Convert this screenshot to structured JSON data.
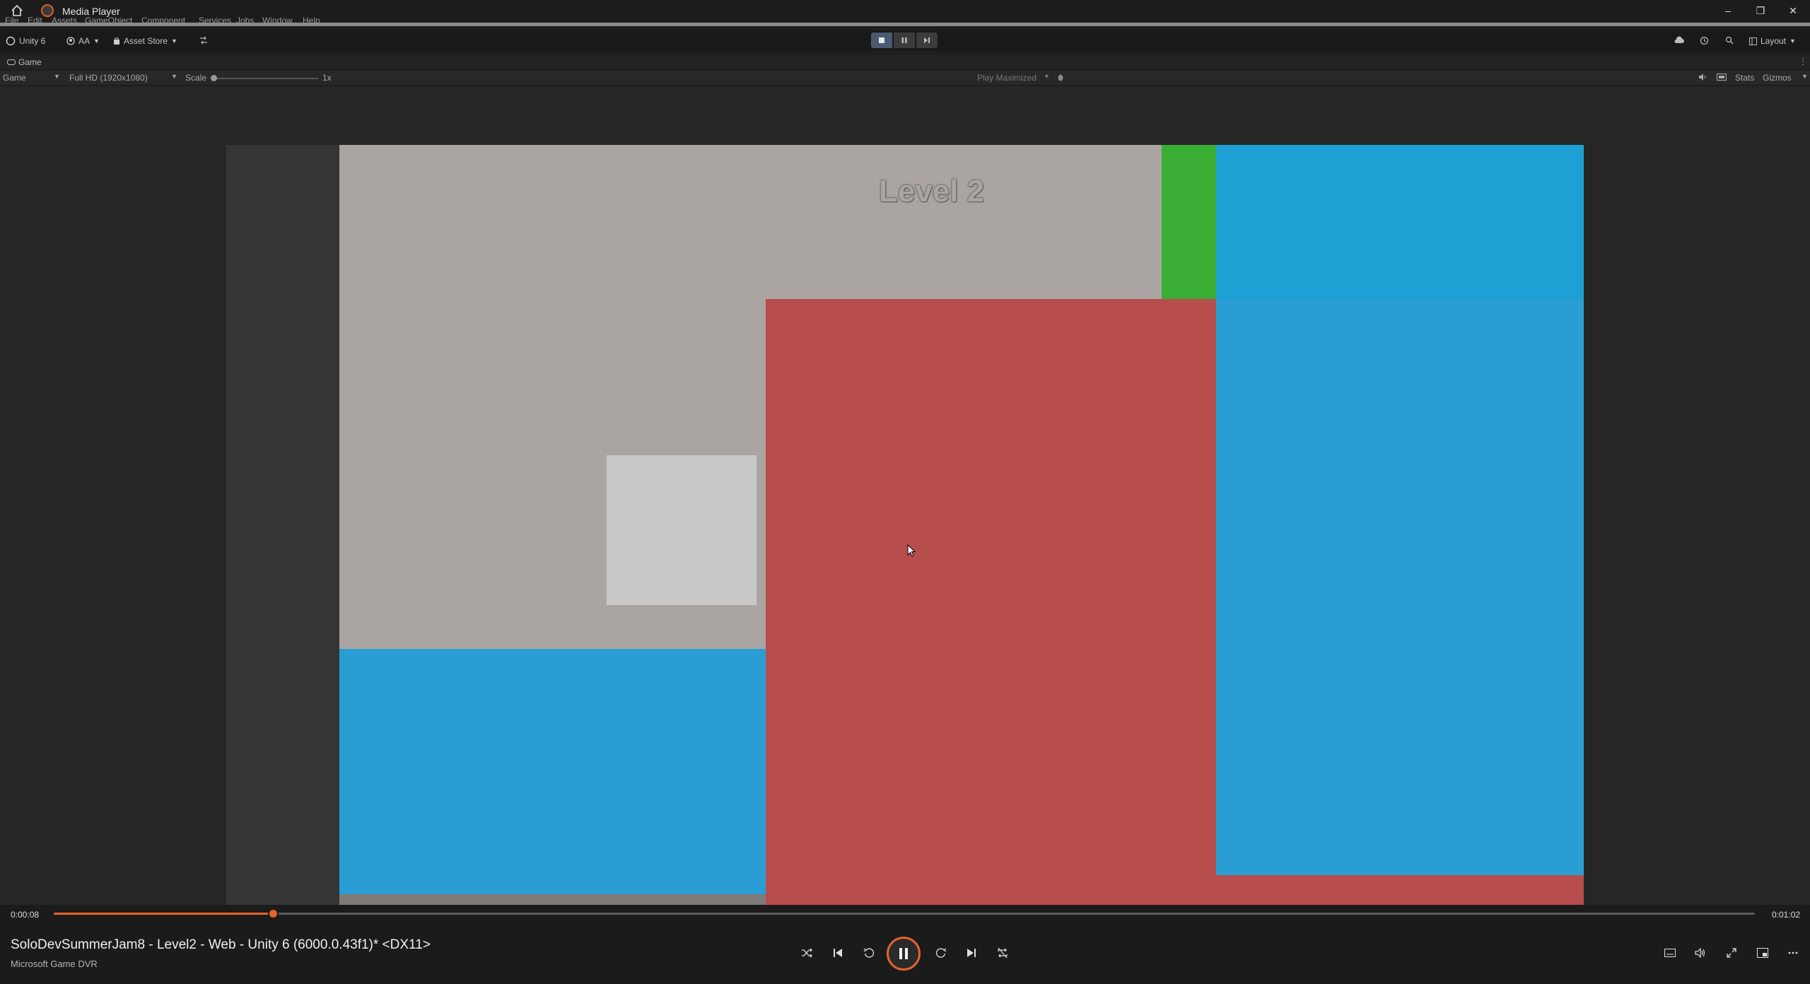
{
  "window": {
    "title": "Media Player",
    "controls": {
      "minimize": "–",
      "restore": "❐",
      "close": "✕"
    }
  },
  "unity": {
    "menu": [
      "File",
      "Edit",
      "Assets",
      "GameObject",
      "Component",
      "Services",
      "Jobs",
      "Window",
      "Help"
    ],
    "toolbar": {
      "account": "Unity 6",
      "user": "AA",
      "asset_store": "Asset Store",
      "layout": "Layout"
    },
    "game_tab": "Game",
    "game_bar": {
      "display": "Game",
      "resolution": "Full HD (1920x1080)",
      "scale_label": "Scale",
      "scale_value": "1x",
      "play_mode": "Play Maximized",
      "stats": "Stats",
      "gizmos": "Gizmos"
    }
  },
  "game": {
    "level_title": "Level 2",
    "colors": {
      "grey": "#aaa5a2",
      "red": "#b84d4d",
      "blue": "#29a0d3",
      "green": "#3aad35",
      "light_box": "#c8c8c8",
      "side_panel": "#353535"
    }
  },
  "player": {
    "current_time": "0:00:08",
    "total_time": "0:01:02",
    "progress": 0.129,
    "media_title": "SoloDevSummerJam8 - Level2 - Web - Unity 6 (6000.0.43f1)* <DX11>",
    "media_subtitle": "Microsoft Game DVR",
    "accent": "#e6632c"
  }
}
